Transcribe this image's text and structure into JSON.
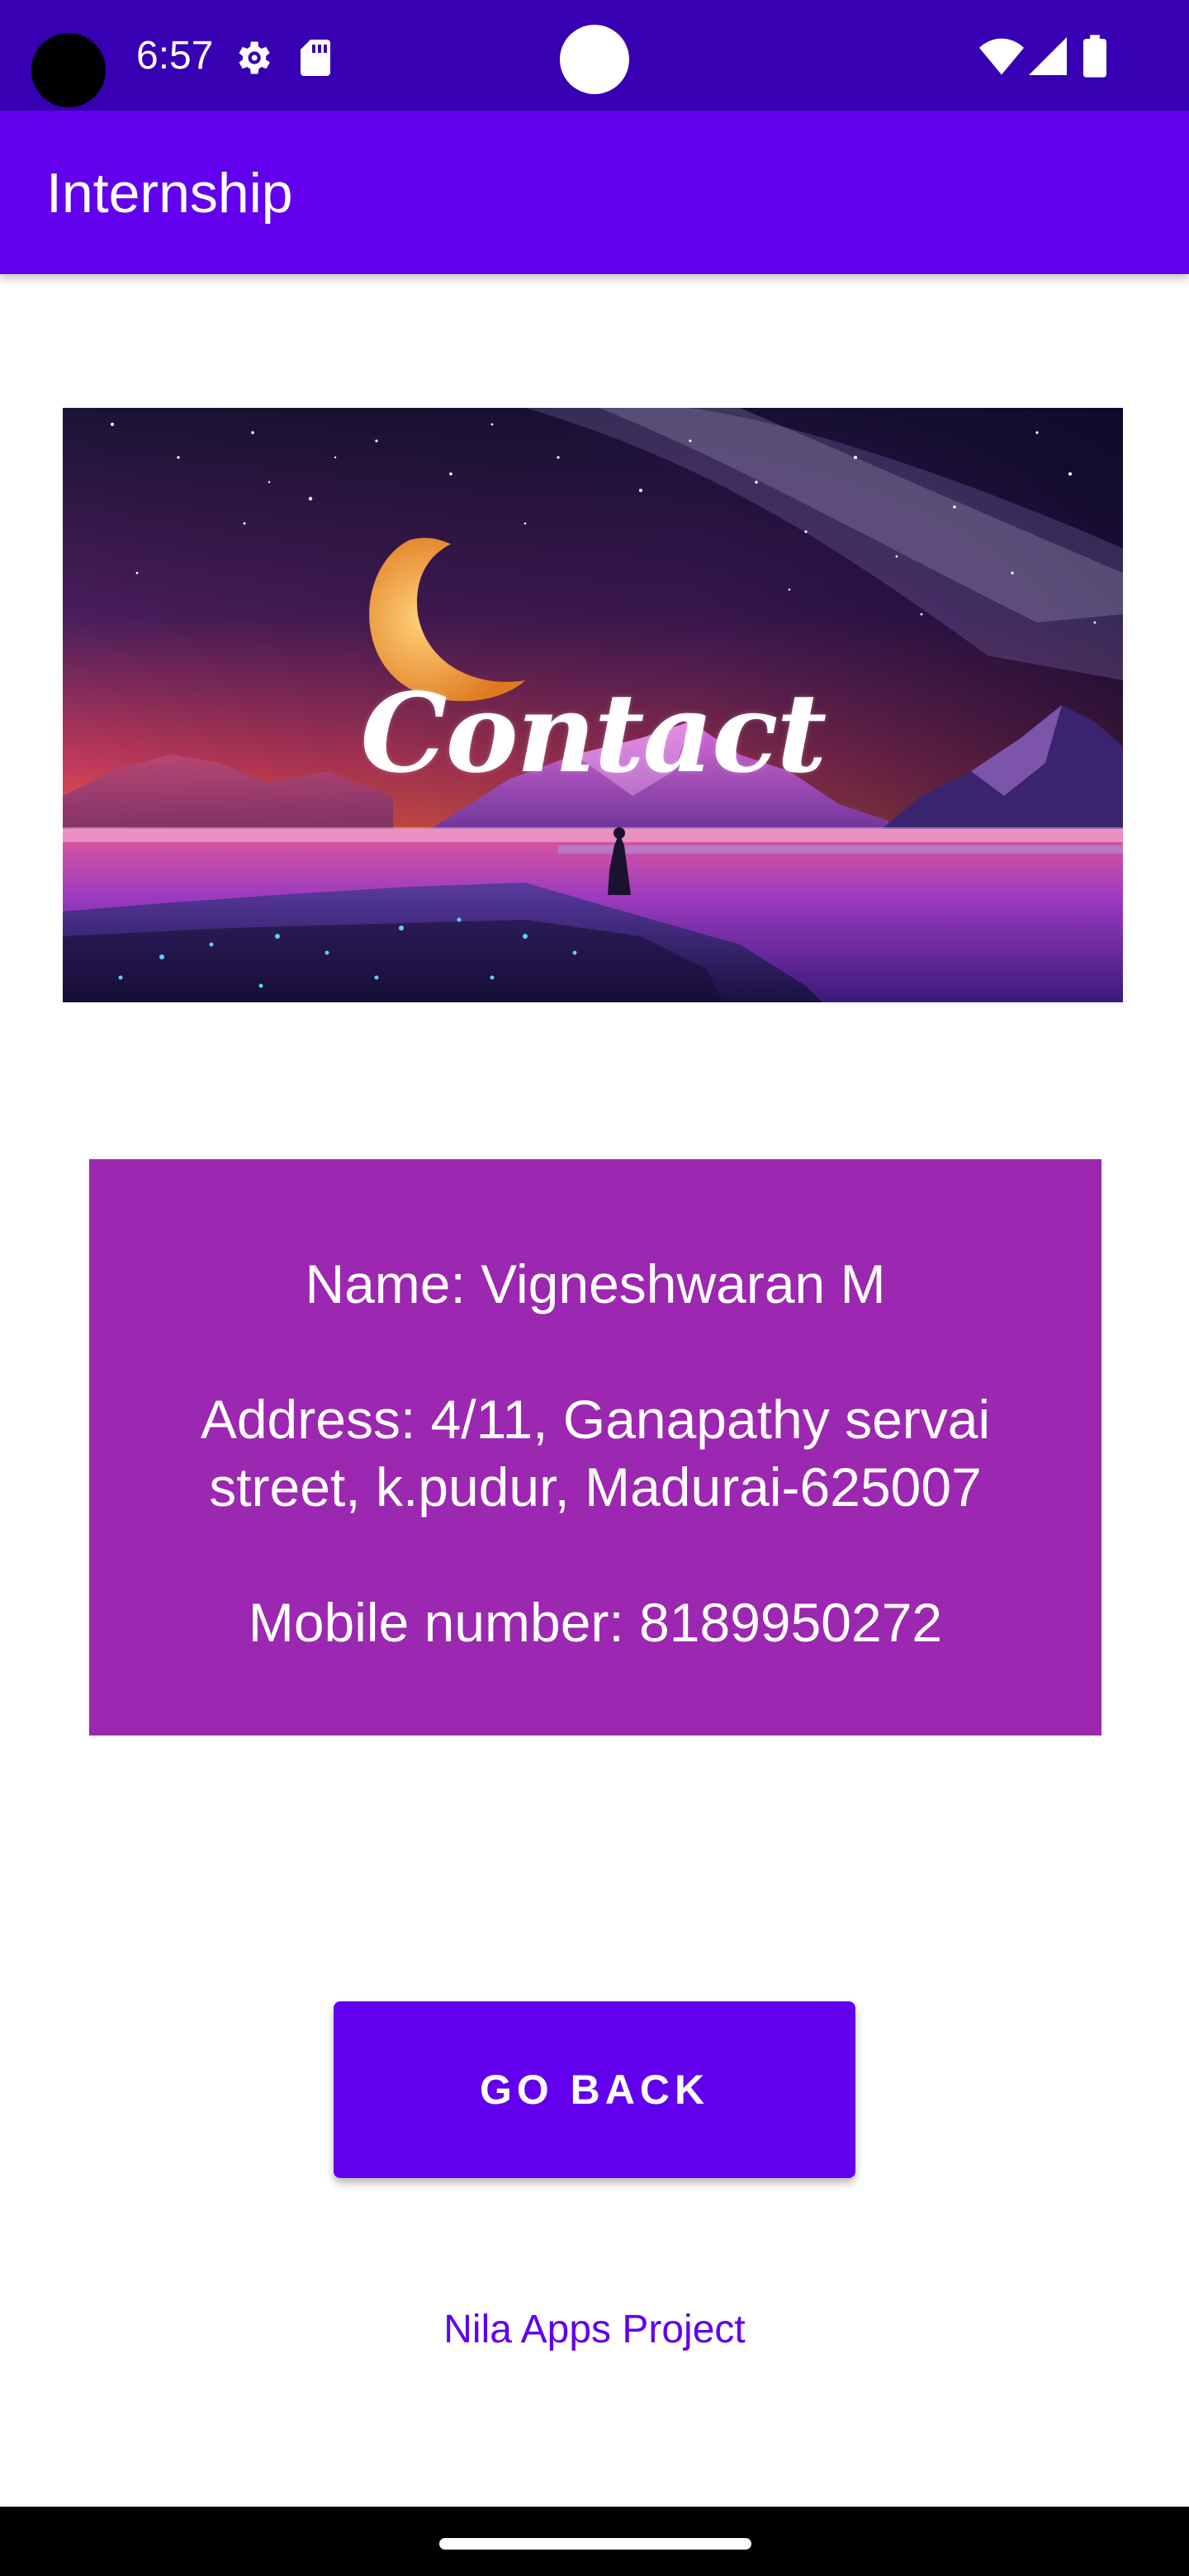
{
  "status_bar": {
    "time": "6:57",
    "icons": [
      "gear-icon",
      "sd-card-icon",
      "wifi-icon",
      "signal-icon",
      "battery-icon"
    ]
  },
  "app_bar": {
    "title": "Internship"
  },
  "banner": {
    "title": "Contact"
  },
  "contact": {
    "name": "Name: Vigneshwaran M",
    "address": "Address: 4/11, Ganapathy servai street, k.pudur, Madurai-625007",
    "mobile": "Mobile number: 8189950272"
  },
  "actions": {
    "go_back_label": "GO BACK"
  },
  "footer": {
    "text": "Nila Apps Project"
  },
  "colors": {
    "status_bar": "#3700b3",
    "primary": "#6200ee",
    "card": "#9c27b0"
  }
}
